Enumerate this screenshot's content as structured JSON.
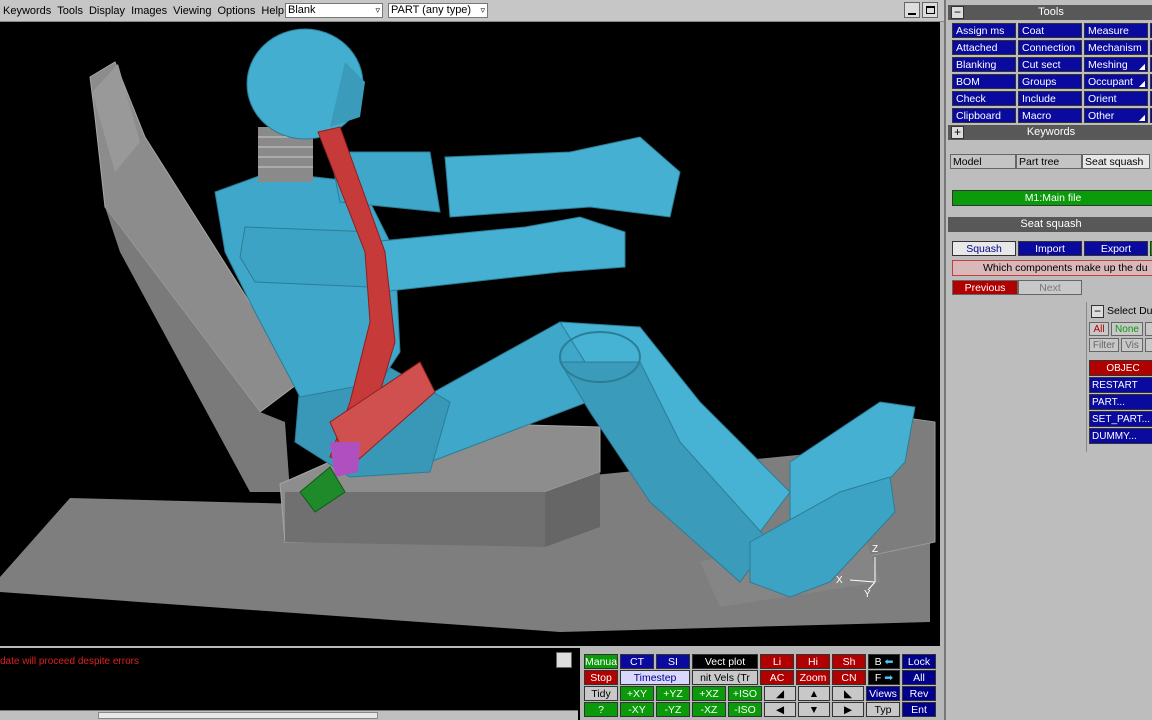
{
  "menubar": {
    "items": [
      "Keywords",
      "Tools",
      "Display",
      "Images",
      "Viewing",
      "Options",
      "Help"
    ],
    "combo1_value": "Blank",
    "combo2_value": "PART  (any type)"
  },
  "viewport": {
    "axes": {
      "x": "X",
      "y": "Y",
      "z": "Z"
    }
  },
  "message": {
    "text": "date will proceed despite errors"
  },
  "controls": {
    "manual": "Manua",
    "stop": "Stop",
    "tidy": "Tidy",
    "ct": "CT",
    "si": "SI",
    "timestep": "Timestep",
    "vect_plot": "Vect plot",
    "init_vels": "nit Vels (Tr",
    "li": "Li",
    "hi": "Hi",
    "sh": "Sh",
    "b": "B",
    "lock": "Lock",
    "ac": "AC",
    "zoom": "Zoom",
    "cn": "CN",
    "f": "F",
    "all": "All",
    "pxy": "+XY",
    "pyz": "+YZ",
    "pxz": "+XZ",
    "piso": "+ISO",
    "nxy": "-XY",
    "nyz": "-YZ",
    "nxz": "-XZ",
    "niso": "-ISO",
    "question": "?",
    "views": "Views",
    "rev": "Rev",
    "typ": "Typ",
    "ent": "Ent"
  },
  "tools": {
    "title": "Tools",
    "buttons": [
      [
        "Assign ms",
        "Coat",
        "Measure"
      ],
      [
        "Attached",
        "Connection",
        "Mechanism"
      ],
      [
        "Blanking",
        "Cut sect",
        "Meshing"
      ],
      [
        "BOM",
        "Groups",
        "Occupant"
      ],
      [
        "Check",
        "Include",
        "Orient"
      ],
      [
        "Clipboard",
        "Macro",
        "Other"
      ]
    ],
    "keywords_title": "Keywords",
    "tabs": [
      "Model",
      "Part tree",
      "Seat squash"
    ],
    "main_file": "M1:Main file"
  },
  "seat_squash": {
    "title": "Seat squash",
    "tabs": [
      "Squash",
      "Import",
      "Export"
    ],
    "question": "Which components make up the du",
    "previous": "Previous",
    "next": "Next",
    "select_title": "Select Du",
    "all": "All",
    "none": "None",
    "filter": "Filter",
    "vis": "Vis",
    "object_header": "OBJEC",
    "objects": [
      "RESTART",
      "PART...",
      "SET_PART...",
      "DUMMY..."
    ]
  },
  "colors": {
    "dummy": "#3fa7c9",
    "seat": "#8a8a8a",
    "belt": "#d03030",
    "viewport_bg": "#000000"
  }
}
